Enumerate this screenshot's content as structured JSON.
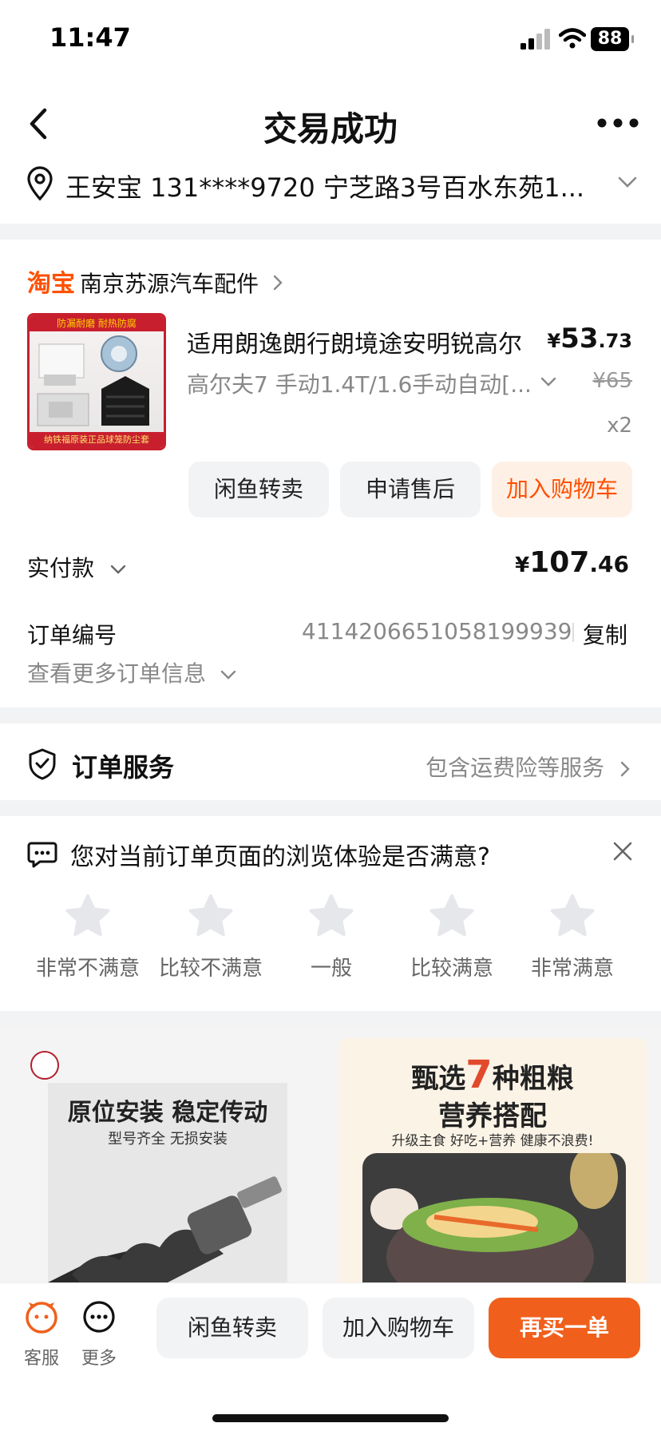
{
  "status_bar": {
    "time": "11:47",
    "battery": "88"
  },
  "header": {
    "title": "交易成功"
  },
  "address": {
    "text": "王安宝 131****9720 宁芝路3号百水东苑1..."
  },
  "order": {
    "shop_logo": "淘宝",
    "shop_name": "南京苏源汽车配件",
    "product": {
      "thumb_top": "防漏耐磨 耐热防腐",
      "thumb_bottom": "纳铁福原装正品球笼防尘套",
      "title": "适用朗逸朗行朗境途安明锐高尔",
      "price_currency": "¥",
      "price_int": "53",
      "price_dec": ".73",
      "spec": "高尔夫7 手动1.4T/1.6手动自动[...",
      "old_price": "¥65",
      "qty": "x2"
    },
    "actions": [
      "闲鱼转卖",
      "申请售后",
      "加入购物车"
    ],
    "paid_label": "实付款",
    "paid_currency": "¥",
    "paid_int": "107",
    "paid_dec": ".46",
    "order_no_label": "订单编号",
    "order_no": "4114206651058199939",
    "copy_label": "复制",
    "more_info": "查看更多订单信息"
  },
  "service": {
    "title": "订单服务",
    "detail": "包含运费险等服务"
  },
  "survey": {
    "question": "您对当前订单页面的浏览体验是否满意?",
    "ratings": [
      "非常不满意",
      "比较不满意",
      "一般",
      "比较满意",
      "非常满意"
    ]
  },
  "promo": {
    "left_line1": "原位安装 稳定传动",
    "left_line2": "型号齐全 无损安装",
    "right_line1_a": "甄选",
    "right_line1_num": "7",
    "right_line1_b": "种粗粮",
    "right_line2": "营养搭配",
    "right_line3": "升级主食 好吃+营养 健康不浪费!"
  },
  "bottom_bar": {
    "service_label": "客服",
    "more_label": "更多",
    "btn_resell": "闲鱼转卖",
    "btn_cart": "加入购物车",
    "btn_rebuy": "再买一单"
  },
  "colors": {
    "accent": "#ff5000",
    "primary_button": "#f0601c",
    "muted_text": "#888888"
  },
  "icons": [
    "back-icon",
    "more-icon",
    "location-pin-icon",
    "chevron-down-icon",
    "chevron-right-icon",
    "shield-check-icon",
    "chat-icon",
    "close-icon",
    "star-icon",
    "customer-service-icon",
    "more-circle-icon"
  ]
}
